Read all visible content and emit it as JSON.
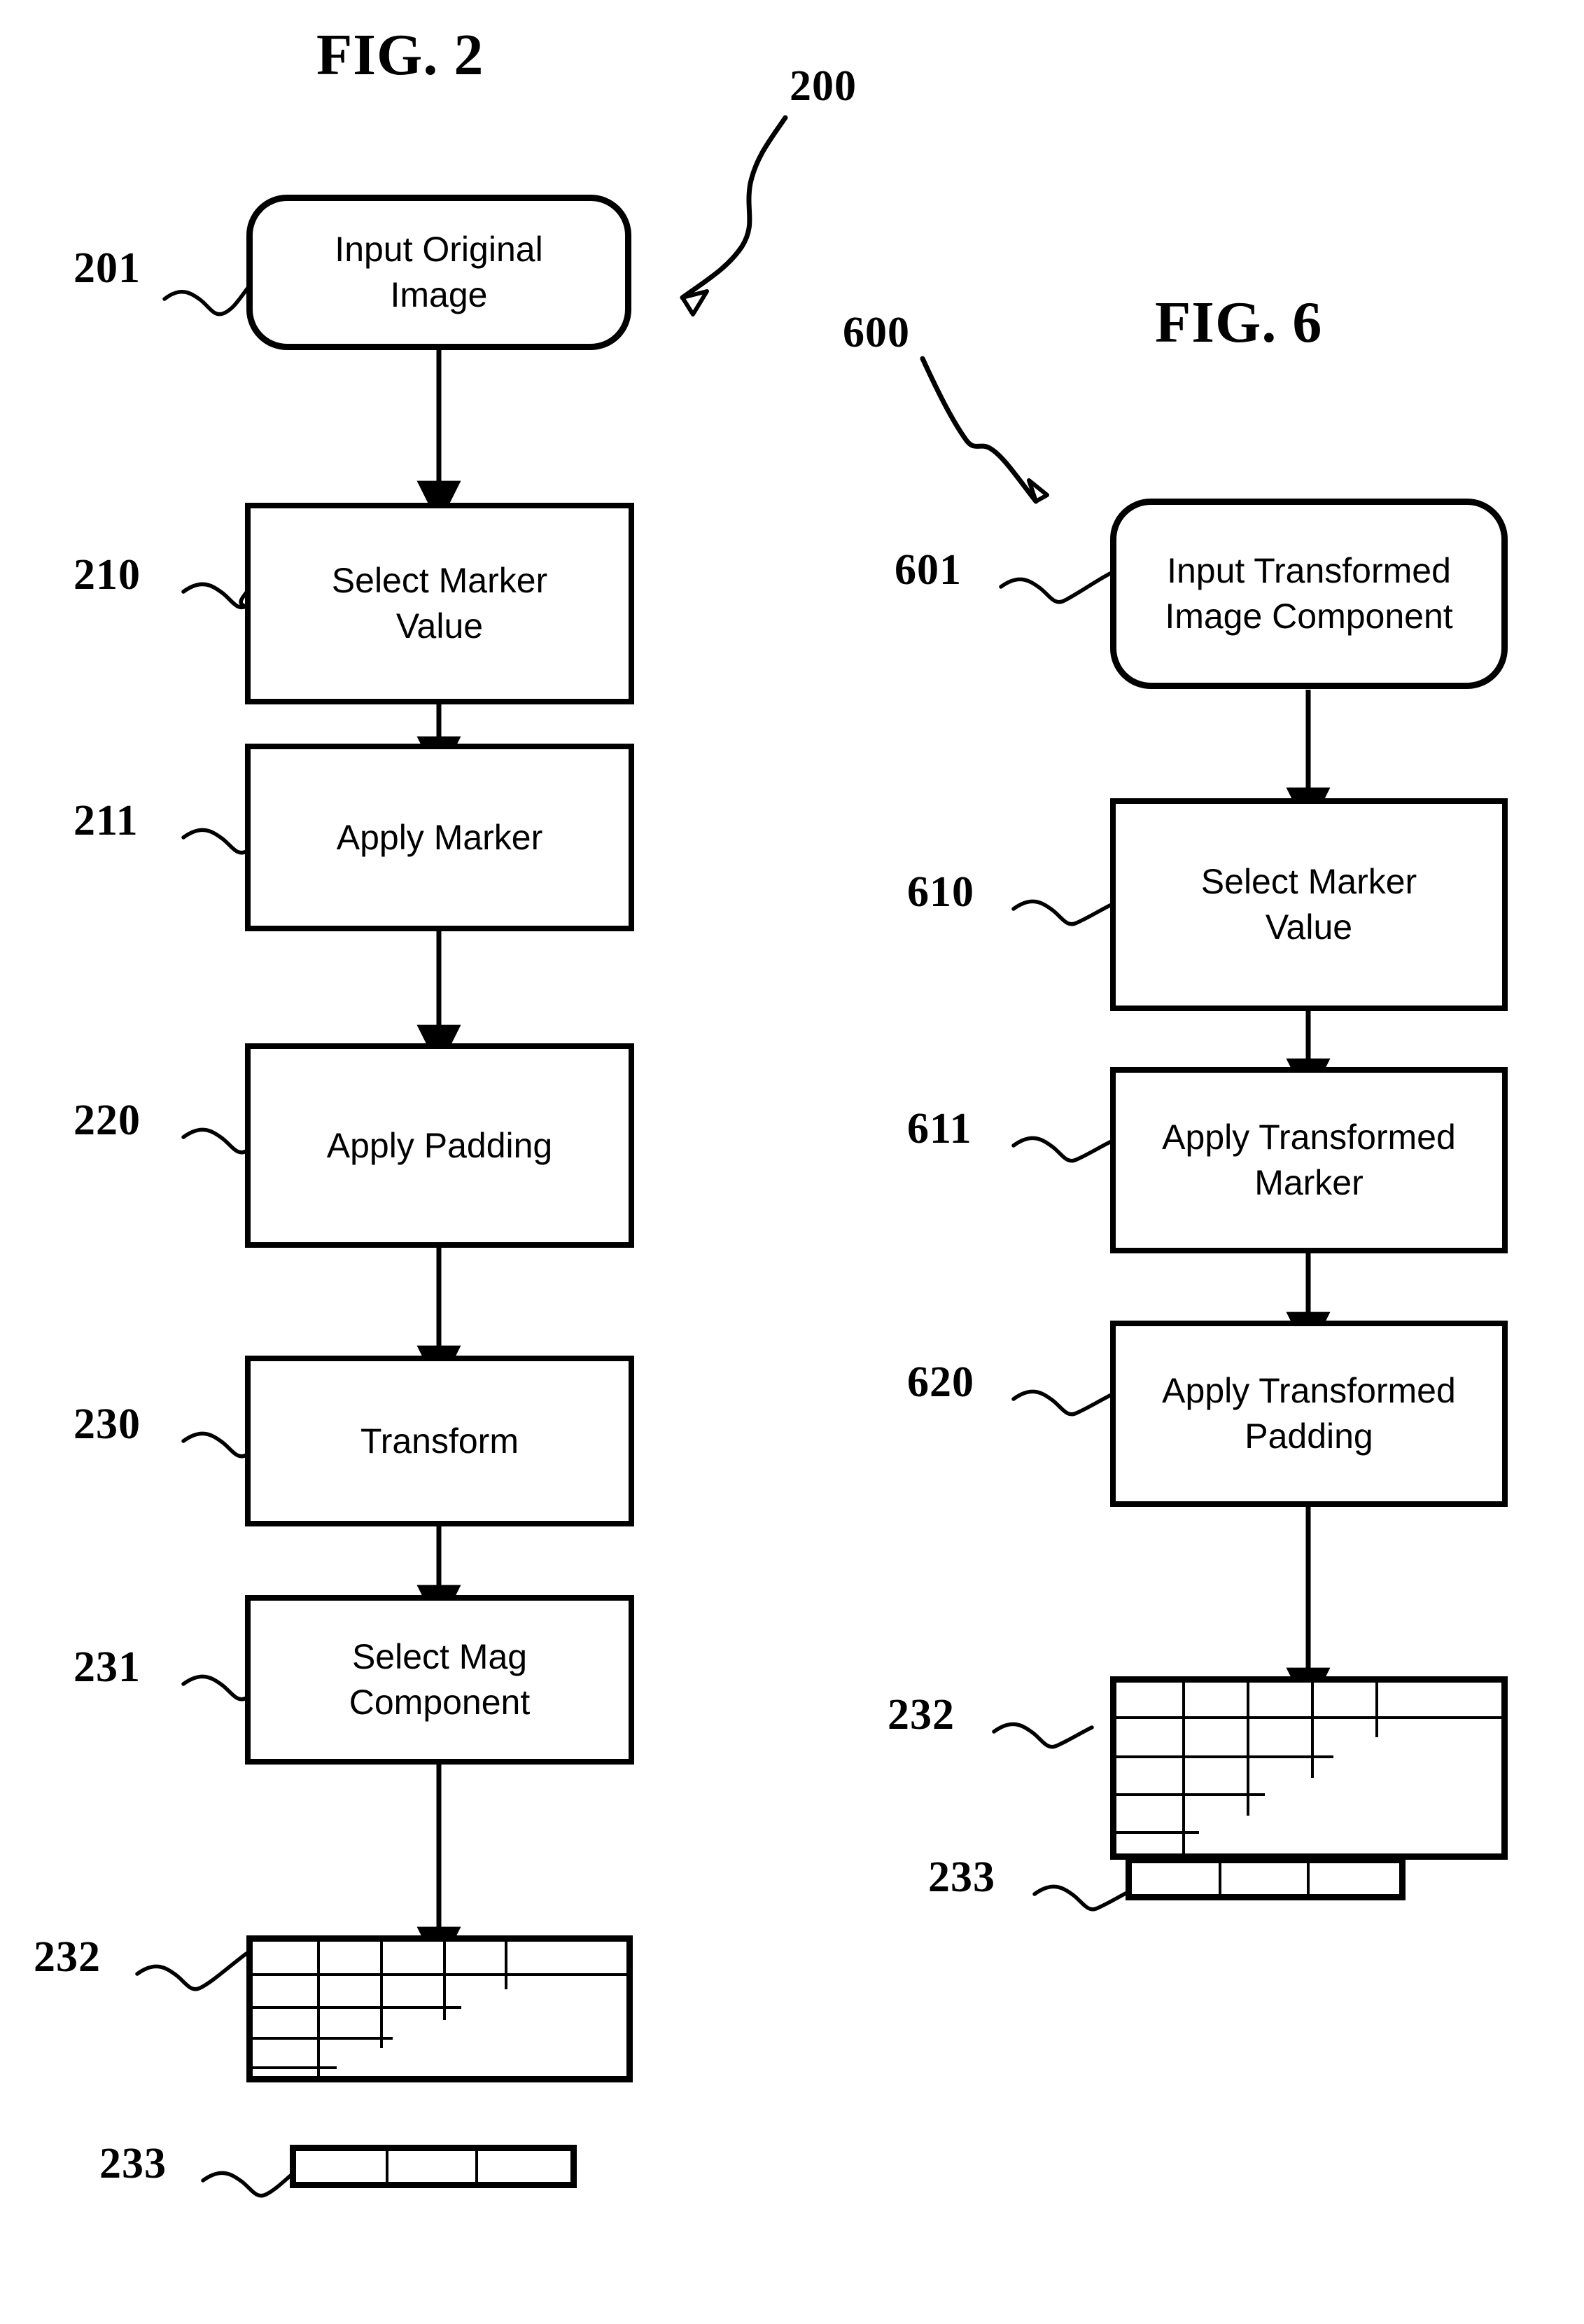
{
  "figures": [
    {
      "title": "FIG. 2",
      "diagram_number": "200",
      "steps": [
        {
          "ref": "201",
          "label": "Input Original\nImage",
          "shape": "terminator"
        },
        {
          "ref": "210",
          "label": "Select Marker\nValue",
          "shape": "process"
        },
        {
          "ref": "211",
          "label": "Apply Marker",
          "shape": "process"
        },
        {
          "ref": "220",
          "label": "Apply Padding",
          "shape": "process"
        },
        {
          "ref": "230",
          "label": "Transform",
          "shape": "process"
        },
        {
          "ref": "231",
          "label": "Select Mag\nComponent",
          "shape": "process"
        },
        {
          "ref": "232",
          "label": "",
          "shape": "grid"
        },
        {
          "ref": "233",
          "label": "",
          "shape": "bar"
        }
      ]
    },
    {
      "title": "FIG. 6",
      "diagram_number": "600",
      "steps": [
        {
          "ref": "601",
          "label": "Input Transformed\nImage Component",
          "shape": "terminator"
        },
        {
          "ref": "610",
          "label": "Select Marker\nValue",
          "shape": "process"
        },
        {
          "ref": "611",
          "label": "Apply Transformed\nMarker",
          "shape": "process"
        },
        {
          "ref": "620",
          "label": "Apply Transformed\nPadding",
          "shape": "process"
        },
        {
          "ref": "232",
          "label": "",
          "shape": "grid"
        },
        {
          "ref": "233",
          "label": "",
          "shape": "bar"
        }
      ]
    }
  ],
  "fig2": {
    "title": "FIG. 2",
    "diagram_number": "200",
    "box_201_line1": "Input Original",
    "box_201_line2": "Image",
    "box_210_line1": "Select Marker",
    "box_210_line2": "Value",
    "box_211_line1": "Apply Marker",
    "box_220_line1": "Apply Padding",
    "box_230_line1": "Transform",
    "box_231_line1": "Select Mag",
    "box_231_line2": "Component",
    "ref_201": "201",
    "ref_210": "210",
    "ref_211": "211",
    "ref_220": "220",
    "ref_230": "230",
    "ref_231": "231",
    "ref_232": "232",
    "ref_233": "233"
  },
  "fig6": {
    "title": "FIG. 6",
    "diagram_number": "600",
    "box_601_line1": "Input Transformed",
    "box_601_line2": "Image Component",
    "box_610_line1": "Select Marker",
    "box_610_line2": "Value",
    "box_611_line1": "Apply Transformed",
    "box_611_line2": "Marker",
    "box_620_line1": "Apply Transformed",
    "box_620_line2": "Padding",
    "ref_601": "601",
    "ref_610": "610",
    "ref_611": "611",
    "ref_620": "620",
    "ref_232": "232",
    "ref_233": "233"
  },
  "colors": {
    "ink": "#000000",
    "paper": "#ffffff"
  }
}
